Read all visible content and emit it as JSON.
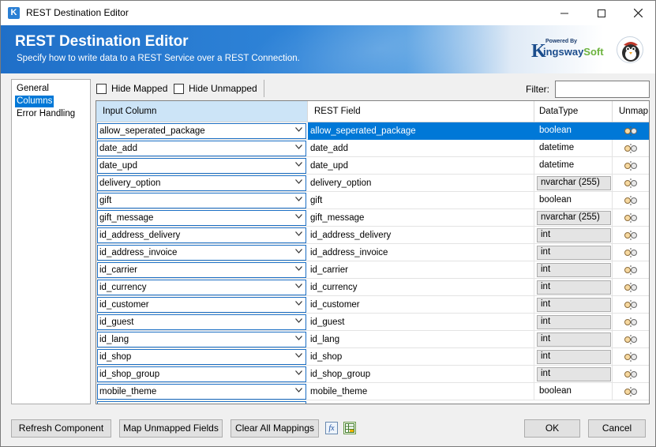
{
  "window": {
    "title": "REST Destination Editor",
    "app_icon": "K"
  },
  "banner": {
    "title": "REST Destination Editor",
    "subtitle": "Specify how to write data to a REST Service over a REST Connection.",
    "brand_powered": "Powered By",
    "brand_k": "K",
    "brand_name_a": "ingsway",
    "brand_name_b": "Soft"
  },
  "nav": {
    "items": [
      "General",
      "Columns",
      "Error Handling"
    ],
    "selected": "Columns"
  },
  "toolbar": {
    "hide_mapped": "Hide Mapped",
    "hide_unmapped": "Hide Unmapped",
    "filter_label": "Filter:",
    "filter_value": ""
  },
  "grid": {
    "headers": {
      "input": "Input Column",
      "rest": "REST Field",
      "type": "DataType",
      "unmap": "Unmap"
    },
    "rows": [
      {
        "input": "allow_seperated_package",
        "rest": "allow_seperated_package",
        "type": "boolean",
        "boxed": false,
        "selected": true
      },
      {
        "input": "date_add",
        "rest": "date_add",
        "type": "datetime",
        "boxed": false
      },
      {
        "input": "date_upd",
        "rest": "date_upd",
        "type": "datetime",
        "boxed": false
      },
      {
        "input": "delivery_option",
        "rest": "delivery_option",
        "type": "nvarchar (255)",
        "boxed": true
      },
      {
        "input": "gift",
        "rest": "gift",
        "type": "boolean",
        "boxed": false
      },
      {
        "input": "gift_message",
        "rest": "gift_message",
        "type": "nvarchar (255)",
        "boxed": true
      },
      {
        "input": "id_address_delivery",
        "rest": "id_address_delivery",
        "type": "int",
        "boxed": true
      },
      {
        "input": "id_address_invoice",
        "rest": "id_address_invoice",
        "type": "int",
        "boxed": true
      },
      {
        "input": "id_carrier",
        "rest": "id_carrier",
        "type": "int",
        "boxed": true
      },
      {
        "input": "id_currency",
        "rest": "id_currency",
        "type": "int",
        "boxed": true
      },
      {
        "input": "id_customer",
        "rest": "id_customer",
        "type": "int",
        "boxed": true
      },
      {
        "input": "id_guest",
        "rest": "id_guest",
        "type": "int",
        "boxed": true
      },
      {
        "input": "id_lang",
        "rest": "id_lang",
        "type": "int",
        "boxed": true
      },
      {
        "input": "id_shop",
        "rest": "id_shop",
        "type": "int",
        "boxed": true
      },
      {
        "input": "id_shop_group",
        "rest": "id_shop_group",
        "type": "int",
        "boxed": true
      },
      {
        "input": "mobile_theme",
        "rest": "mobile_theme",
        "type": "boolean",
        "boxed": false
      }
    ]
  },
  "buttons": {
    "refresh": "Refresh Component",
    "map_unmapped": "Map Unmapped Fields",
    "clear_all": "Clear All Mappings",
    "fx_icon": "fx",
    "ok": "OK",
    "cancel": "Cancel"
  },
  "icons": {
    "unmap": "unmap-icon",
    "fx": "fx-icon",
    "table": "table-icon"
  },
  "colors": {
    "accent": "#0078d7",
    "banner": "#1f6fc8",
    "brand_green": "#6cb33e"
  }
}
